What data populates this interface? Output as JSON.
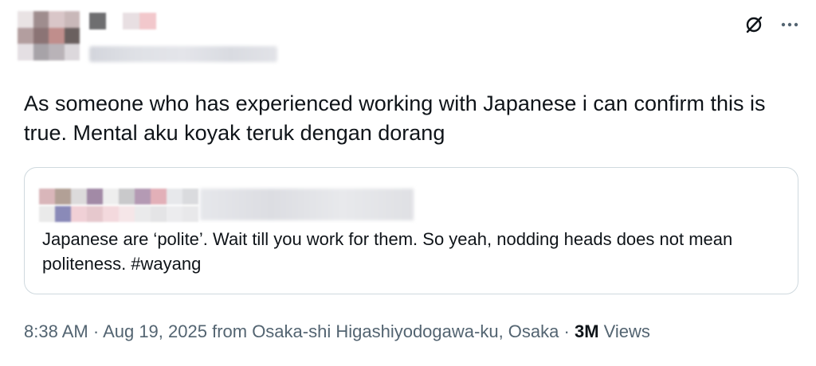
{
  "tweet": {
    "text": "As someone who has experienced working with Japanese i can confirm this is true. Mental aku koyak teruk dengan dorang"
  },
  "actions": {
    "grok_icon": "grok-icon",
    "more_icon": "more-icon"
  },
  "quote": {
    "text": "Japanese are ‘polite’. Wait till you work for them. So yeah, nodding heads does not mean politeness. #wayang"
  },
  "meta": {
    "time": "8:38 AM",
    "separator1": " · ",
    "date": "Aug 19, 2025",
    "location": " from Osaka-shi Higashiyodogawa-ku, Osaka",
    "separator2": " · ",
    "views_count": "3M",
    "views_label": " Views"
  },
  "colors": {
    "text": "#0f1419",
    "secondary": "#536471",
    "border": "#cfd9de"
  }
}
